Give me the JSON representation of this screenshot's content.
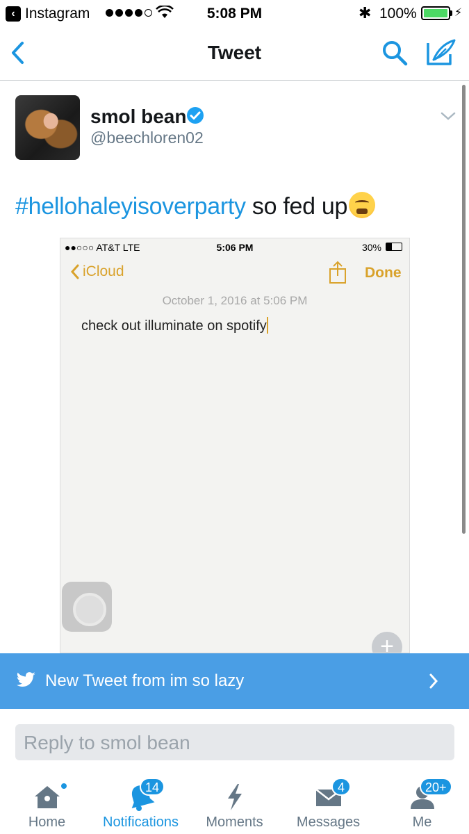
{
  "status_bar": {
    "back_app": "Instagram",
    "time": "5:08 PM",
    "battery_pct": "100%",
    "signal_bars": 4
  },
  "nav": {
    "title": "Tweet"
  },
  "tweet": {
    "author_name": "smol bean",
    "author_handle": "@beechloren02",
    "hashtag": "#hellohaleyisoverparty",
    "text": " so fed up",
    "emoji": "face-with-steam-emoji"
  },
  "media": {
    "carrier": "●●○○○ AT&T  LTE",
    "time": "5:06 PM",
    "battery_pct": "30%",
    "back_label": "iCloud",
    "done_label": "Done",
    "date": "October 1, 2016 at 5:06 PM",
    "body": "check out illuminate on spotify",
    "add_symbol": "+"
  },
  "banner": {
    "text": "New Tweet from im so lazy"
  },
  "reply": {
    "placeholder": "Reply to smol bean"
  },
  "tabs": [
    {
      "label": "Home",
      "icon": "home-icon",
      "badge": ""
    },
    {
      "label": "Notifications",
      "icon": "bell-icon",
      "badge": "14"
    },
    {
      "label": "Moments",
      "icon": "lightning-icon",
      "badge": ""
    },
    {
      "label": "Messages",
      "icon": "envelope-icon",
      "badge": "4"
    },
    {
      "label": "Me",
      "icon": "person-icon",
      "badge": "20+"
    }
  ],
  "colors": {
    "twitter_blue": "#1b95e0",
    "banner_blue": "#4a9ee5",
    "notes_gold": "#d9a22b",
    "battery_green": "#4cd964"
  }
}
